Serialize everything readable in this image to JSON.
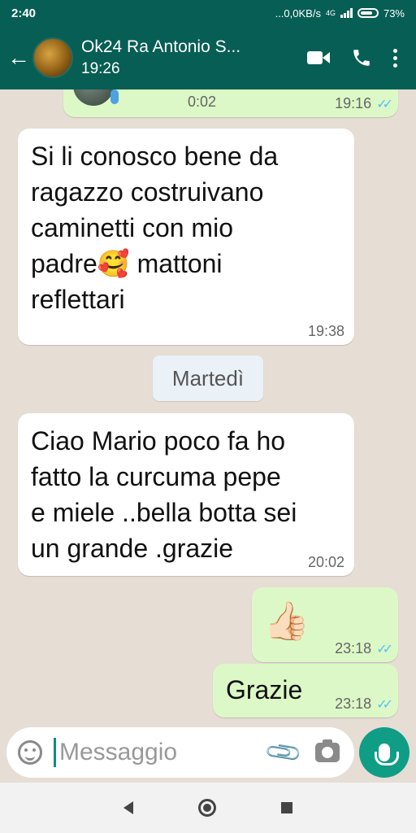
{
  "status_bar": {
    "time": "2:40",
    "data_rate": "...0,0KB/s",
    "network": "4G",
    "battery": "73%"
  },
  "header": {
    "contact_name": "Ok24 Ra Antonio S...",
    "status": "19:26"
  },
  "messages": [
    {
      "type": "voice",
      "direction": "out",
      "duration": "0:02",
      "time": "19:16",
      "ticks": "✓✓"
    },
    {
      "type": "text",
      "direction": "in",
      "lines": [
        "Si li conosco bene da",
        "ragazzo costruivano",
        "caminetti con mio",
        "padre🥰 mattoni",
        "reflettari"
      ],
      "time": "19:38"
    },
    {
      "type": "text",
      "direction": "in",
      "lines": [
        "Ciao Mario poco fa ho",
        "fatto la curcuma pepe",
        "e miele ..bella botta sei",
        "un grande .grazie"
      ],
      "time": "20:02"
    },
    {
      "type": "emoji",
      "direction": "out",
      "text": "👍🏻",
      "time": "23:18",
      "ticks": "✓✓"
    },
    {
      "type": "text",
      "direction": "out",
      "text": "Grazie",
      "time": "23:18",
      "ticks": "✓✓"
    }
  ],
  "day_separator": "Martedì",
  "input": {
    "placeholder": "Messaggio"
  },
  "colors": {
    "header": "#075e54",
    "outgoing": "#dcf8c6",
    "incoming": "#ffffff",
    "accent": "#0f9d86",
    "read_ticks": "#4fc3f7"
  }
}
